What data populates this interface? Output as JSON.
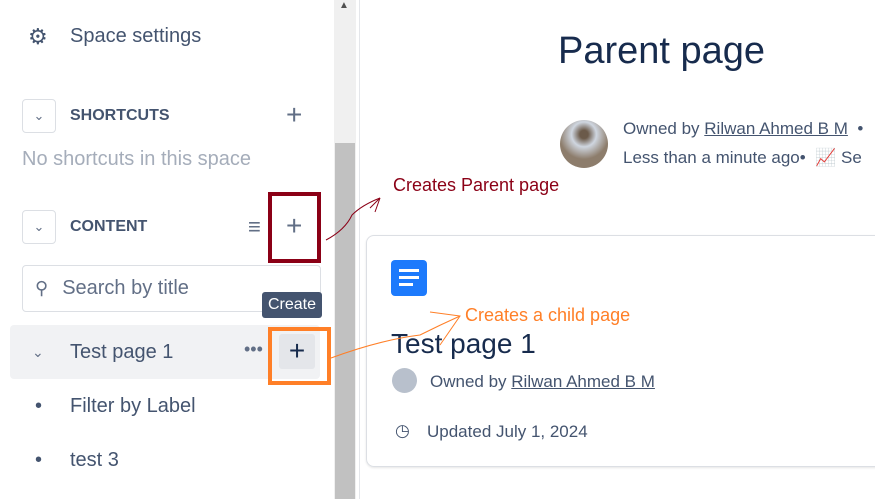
{
  "sidebar": {
    "space_settings": "Space settings",
    "shortcuts_label": "SHORTCUTS",
    "no_shortcuts": "No shortcuts in this space",
    "content_label": "CONTENT",
    "search_placeholder": "Search by title",
    "tooltip": "Create",
    "items": [
      {
        "label": "Test page 1"
      },
      {
        "label": "Filter by Label"
      },
      {
        "label": "test 3"
      }
    ]
  },
  "page": {
    "title": "Parent page",
    "owned_by": "Owned by",
    "owner": "Rilwan Ahmed B M",
    "time": "Less than a minute ago",
    "analytics": "Se",
    "card": {
      "title": "Test page 1",
      "owned_by": "Owned by",
      "owner": "Rilwan Ahmed B M",
      "updated": "Updated July 1, 2024"
    }
  },
  "annotations": {
    "parent": "Creates Parent page",
    "child": "Creates a child page",
    "parent_color": "#8b0016",
    "child_color": "#ff7f27"
  }
}
